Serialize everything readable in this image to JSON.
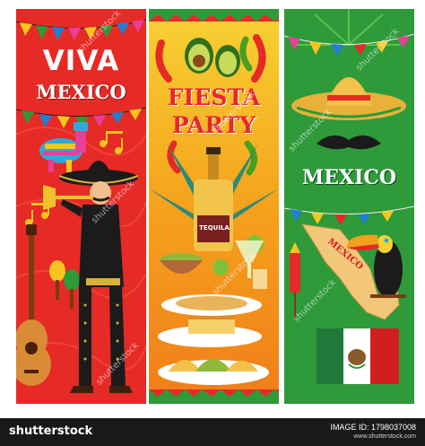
{
  "banners": [
    {
      "title_line1": "VIVA",
      "title_line2": "MEXICO"
    },
    {
      "title_line1": "FIESTA",
      "title_line2": "PARTY",
      "bottle_label": "TEQUILA"
    },
    {
      "title": "MEXICO",
      "map_label": "MEXICO"
    }
  ],
  "watermark": "shutterstock",
  "footer": {
    "logo": "shutterstock",
    "image_id": "IMAGE ID: 1798037008",
    "url": "www.shutterstock.com"
  },
  "colors": {
    "red": "#e62a26",
    "orange": "#f5a21c",
    "green": "#2e9a3a",
    "black": "#18191b"
  }
}
